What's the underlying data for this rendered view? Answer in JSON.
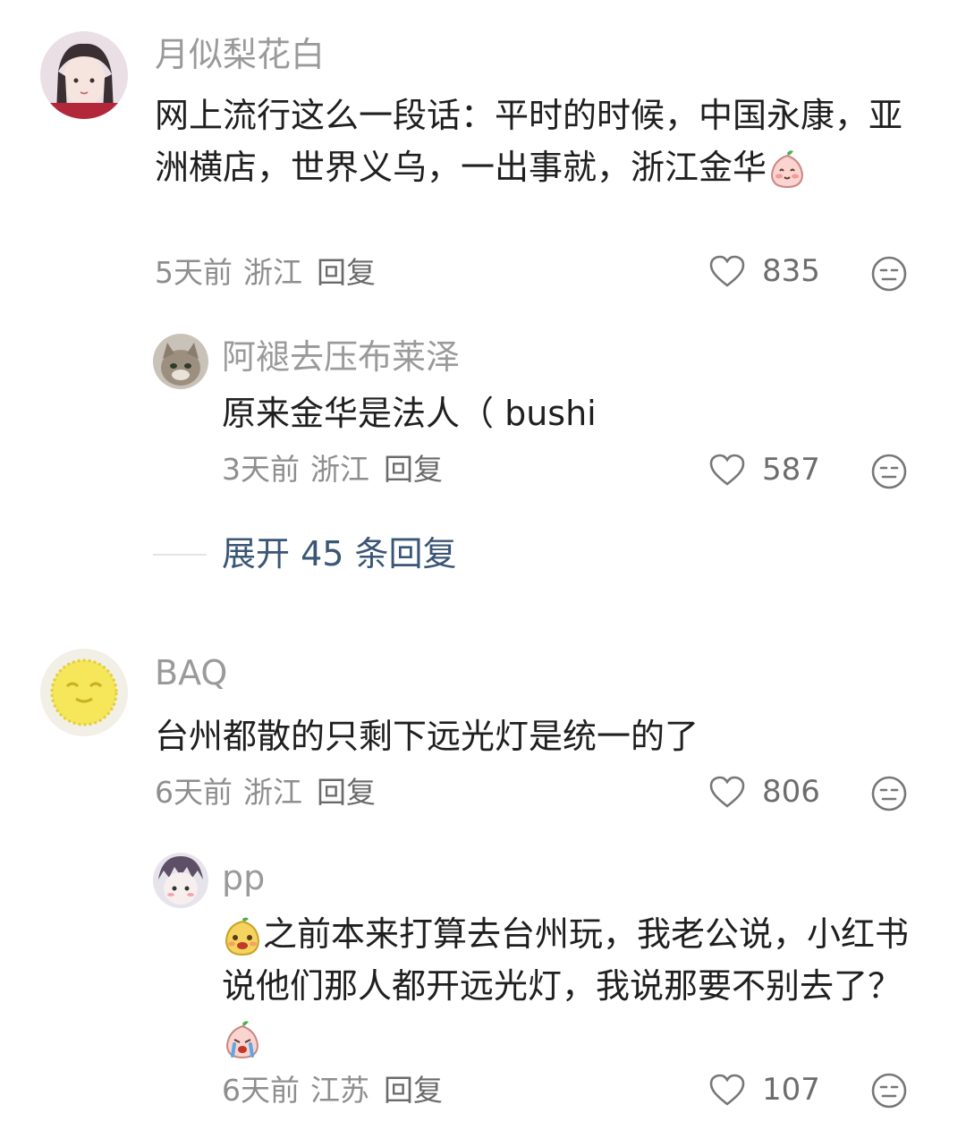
{
  "comments": [
    {
      "username": "月似梨花白",
      "text_before_emoji": "网上流行这么一段话：平时的时候，中国永康，亚洲横店，世界义乌，一出事就，浙江金华",
      "emoji": "peach-smile-emoji",
      "time": "5天前",
      "location": "浙江",
      "reply_label": "回复",
      "likes": "835"
    },
    {
      "username": "阿褪去压布莱泽",
      "text": "原来金华是法人（ bushi",
      "time": "3天前",
      "location": "浙江",
      "reply_label": "回复",
      "likes": "587"
    },
    {
      "username": "BAQ",
      "text": "台州都散的只剩下远光灯是统一的了",
      "time": "6天前",
      "location": "浙江",
      "reply_label": "回复",
      "likes": "806"
    },
    {
      "username": "pp",
      "emoji_lead": "yellow-face-emoji",
      "text_before_emoji": "之前本来打算去台州玩，我老公说，小红书说他们那人都开远光灯，我说那要不别去了？",
      "emoji": "crying-peach-emoji",
      "time": "6天前",
      "location": "江苏",
      "reply_label": "回复",
      "likes": "107"
    }
  ],
  "expand_replies": "展开 45 条回复",
  "icons": {
    "like": "heart-outline-icon",
    "emoji_button": "face-emoji-icon"
  },
  "colors": {
    "username": "#9a9a9a",
    "text": "#1f1f1f",
    "meta": "#8e8e8e",
    "expand": "#3a5675"
  }
}
